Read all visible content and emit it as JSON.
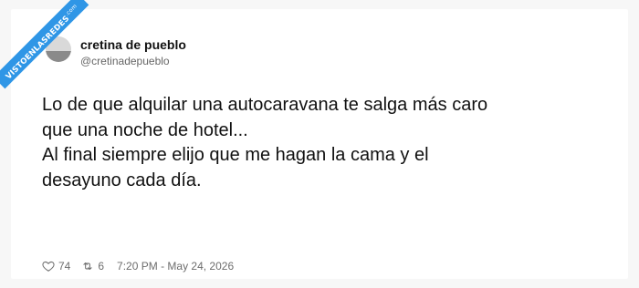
{
  "watermark": {
    "text": "VISTOENLASREDES",
    "suffix": ".com"
  },
  "author": {
    "name": "cretina de pueblo",
    "handle": "@cretinadepueblo"
  },
  "tweet": {
    "lines": [
      "Lo de que alquilar una autocaravana te salga más caro",
      "que una noche de hotel...",
      "Al final siempre elijo que me hagan la cama y el",
      "desayuno cada día."
    ]
  },
  "footer": {
    "likes": "74",
    "retweets": "6",
    "timestamp": "7:20 PM - May 24, 2026"
  },
  "icons": {
    "like": "heart-icon",
    "retweet": "retweet-icon"
  },
  "colors": {
    "ribbon": "#2f96e6",
    "text": "#111111",
    "muted": "#6d6d6d"
  }
}
